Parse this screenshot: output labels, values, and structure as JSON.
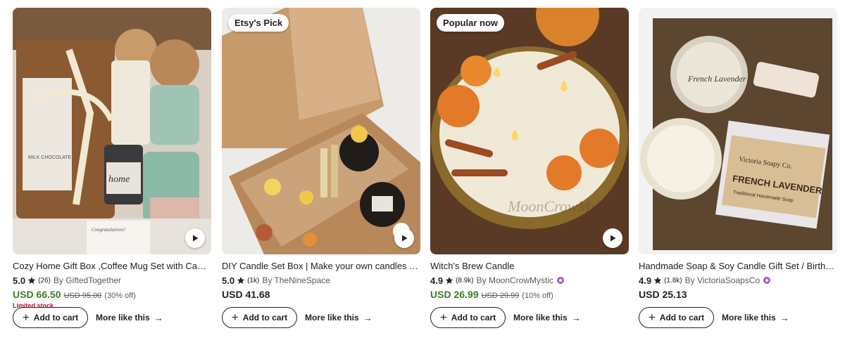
{
  "products": [
    {
      "badge": "",
      "title": "Cozy Home Gift Box ,Coffee Mug Set with Candle ...",
      "rating": "5.0",
      "reviews": "(26)",
      "shop": "By GiftedTogether",
      "verified": false,
      "price": "USD 66.50",
      "original_price": "USD 95.00",
      "discount": "(30% off)",
      "on_sale": true,
      "stock_note": "Limited stock",
      "add_to_cart": "Add to cart",
      "more_like_this": "More like this",
      "arrow_icon": "→"
    },
    {
      "badge": "Etsy's Pick",
      "title": "DIY Candle Set Box | Make your own candles | Gift...",
      "rating": "5.0",
      "reviews": "(1k)",
      "shop": "By TheNineSpace",
      "verified": false,
      "price": "USD 41.68",
      "original_price": "",
      "discount": "",
      "on_sale": false,
      "stock_note": "",
      "add_to_cart": "Add to cart",
      "more_like_this": "More like this",
      "arrow_icon": "→"
    },
    {
      "badge": "Popular now",
      "title": "Witch's Brew Candle",
      "rating": "4.9",
      "reviews": "(8.9k)",
      "shop": "By MoonCrowMystic",
      "verified": true,
      "price": "USD 26.99",
      "original_price": "USD 29.99",
      "discount": "(10% off)",
      "on_sale": true,
      "stock_note": "",
      "add_to_cart": "Add to cart",
      "more_like_this": "More like this",
      "arrow_icon": "→"
    },
    {
      "badge": "",
      "title": "Handmade Soap & Soy Candle Gift Set / Birthday /...",
      "rating": "4.9",
      "reviews": "(1.8k)",
      "shop": "By VictoriaSoapsCo",
      "verified": true,
      "price": "USD 25.13",
      "original_price": "",
      "discount": "",
      "on_sale": false,
      "stock_note": "",
      "add_to_cart": "Add to cart",
      "more_like_this": "More like this",
      "arrow_icon": "→"
    }
  ],
  "image_text": {
    "mug": "home",
    "chocolate": "MILK CHOCOLATE",
    "card": "Congratulations!",
    "watermark": "MoonCrowMystic",
    "tin_label": "French Lavender",
    "soap_brand": "Victoria Soapy Co.",
    "soap_title": "FRENCH LAVENDER",
    "soap_sub": "Traditional Handmade Soap"
  },
  "colors": {
    "sale_price": "#3b7d23",
    "limited_stock": "#a61a2e",
    "verified_badge": "#9c5fb8"
  }
}
